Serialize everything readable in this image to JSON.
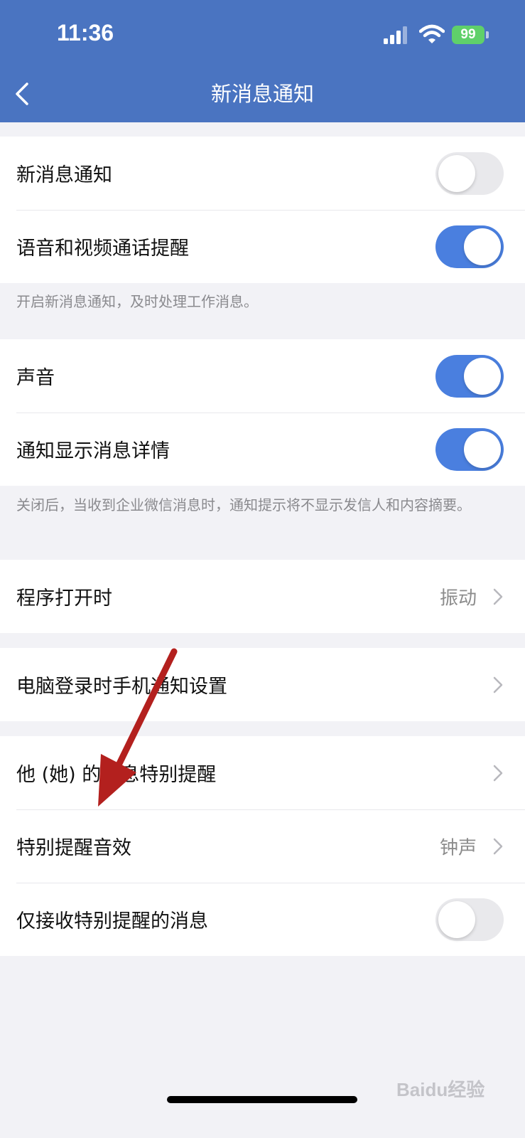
{
  "status_bar": {
    "time": "11:36",
    "battery": "99"
  },
  "nav": {
    "title": "新消息通知",
    "back_icon": "chevron-left-icon"
  },
  "group1": {
    "rows": [
      {
        "label": "新消息通知",
        "toggle": "off"
      },
      {
        "label": "语音和视频通话提醒",
        "toggle": "on"
      }
    ],
    "note": "开启新消息通知，及时处理工作消息。"
  },
  "group2": {
    "rows": [
      {
        "label": "声音",
        "toggle": "on"
      },
      {
        "label": "通知显示消息详情",
        "toggle": "on"
      }
    ],
    "note": "关闭后，当收到企业微信消息时，通知提示将不显示发信人和内容摘要。"
  },
  "group3": {
    "rows": [
      {
        "label": "程序打开时",
        "value": "振动"
      }
    ]
  },
  "group4": {
    "rows": [
      {
        "label": "电脑登录时手机通知设置"
      }
    ]
  },
  "group5": {
    "rows": [
      {
        "label": "他 (她) 的消息特别提醒"
      },
      {
        "label": "特别提醒音效",
        "value": "钟声"
      },
      {
        "label": "仅接收特别提醒的消息",
        "toggle": "off"
      }
    ]
  },
  "watermark": "Baidu经验",
  "colors": {
    "header": "#4a74c1",
    "toggle_on": "#4a7fdf",
    "annotation_arrow": "#b3201e"
  }
}
